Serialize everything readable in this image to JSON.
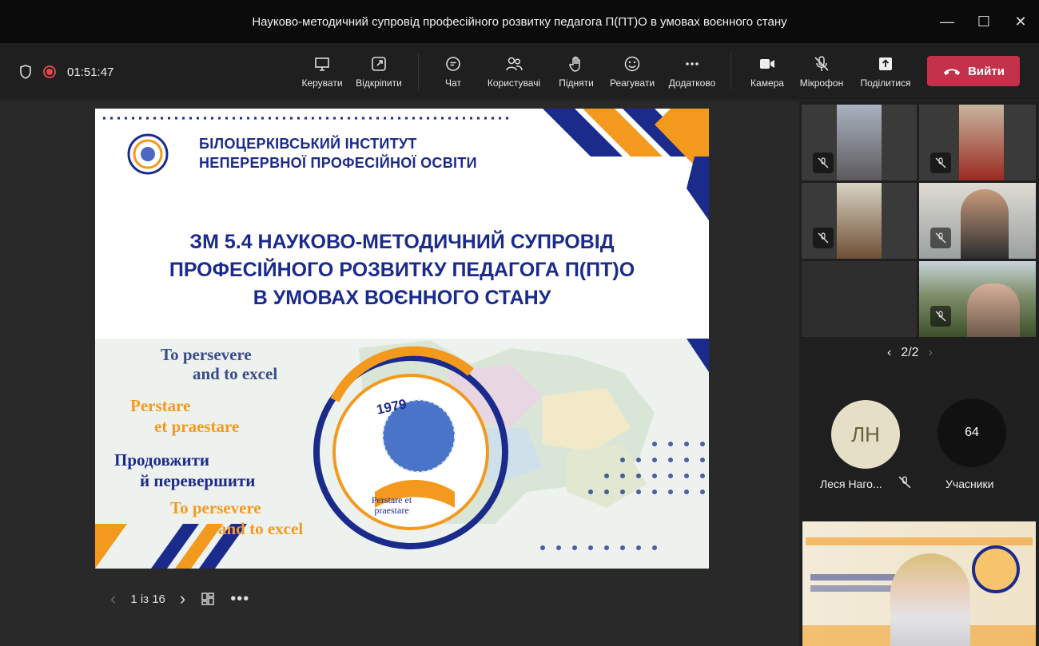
{
  "window": {
    "title": "Науково-методичний супровід професійного розвитку педагога П(ПТ)О в умовах воєнного стану"
  },
  "status": {
    "timer": "01:51:47"
  },
  "toolbar": {
    "manage": "Керувати",
    "popout": "Відкріпити",
    "chat": "Чат",
    "people": "Користувачі",
    "raise": "Підняти",
    "react": "Реагувати",
    "more": "Додатково",
    "camera": "Камера",
    "mic": "Мікрофон",
    "share": "Поділитися",
    "leave": "Вийти"
  },
  "slide": {
    "institute_line1": "БІЛОЦЕРКІВСЬКИЙ ІНСТИТУТ",
    "institute_line2": "НЕПЕРЕРВНОЇ ПРОФЕСІЙНОЇ ОСВІТИ",
    "heading1": "ЗМ 5.4  НАУКОВО-МЕТОДИЧНИЙ СУПРОВІД",
    "heading2": "ПРОФЕСІЙНОГО РОЗВИТКУ ПЕДАГОГА П(ПТ)О",
    "heading3": "В УМОВАХ ВОЄННОГО СТАНУ",
    "motto1a": "To persevere",
    "motto1b": "and to excel",
    "motto2a": "Perstare",
    "motto2b": "et praestare",
    "motto3a": "Продовжити",
    "motto3b": "й перевершити",
    "motto4a": "To persevere",
    "motto4b": "and to excel",
    "logo_year": "1979",
    "logo_text": "Perstare et praestare"
  },
  "slide_nav": {
    "page": "1 із 16"
  },
  "side": {
    "pager": "2/2",
    "participant_initials": "ЛН",
    "participant_name": "Леся Наго...",
    "participants_count": "64",
    "participants_label": "Учасники"
  },
  "colors": {
    "accent": "#c4314b",
    "slide_blue": "#1b2b8c",
    "slide_orange": "#f39a1e"
  }
}
